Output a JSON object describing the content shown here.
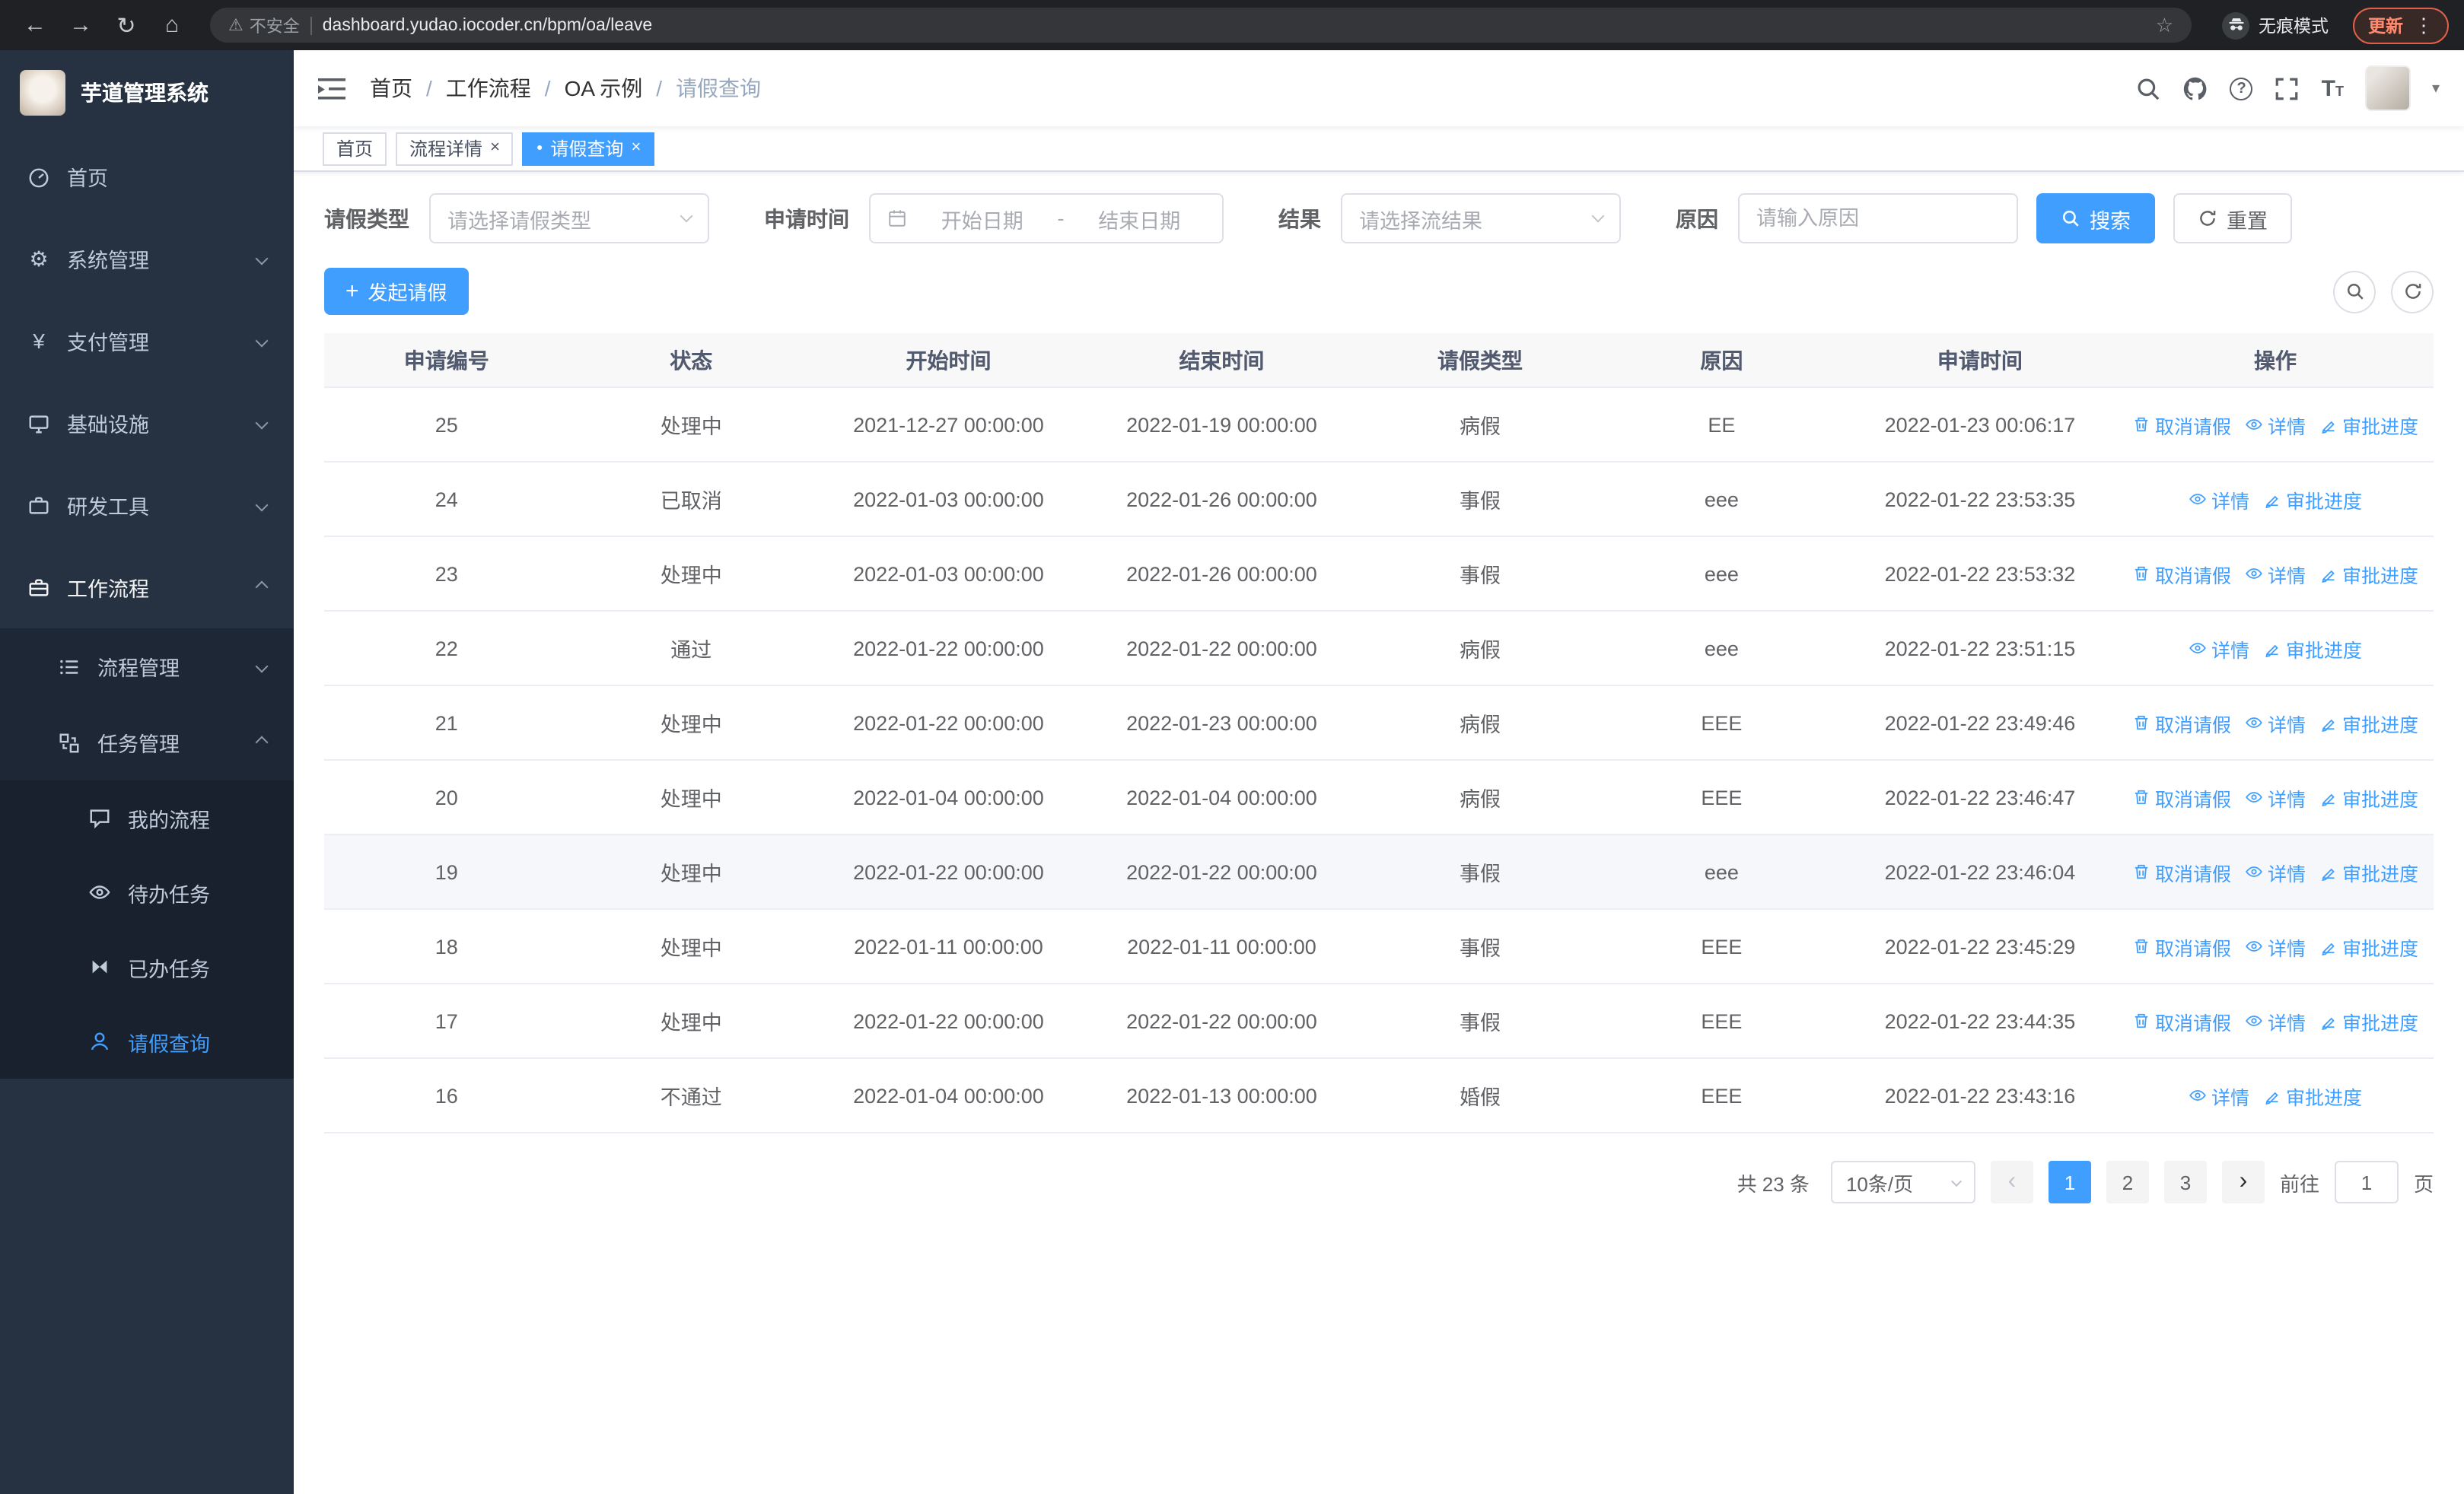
{
  "browser": {
    "security_label": "不安全",
    "url": "dashboard.yudao.iocoder.cn/bpm/oa/leave",
    "incognito_label": "无痕模式",
    "update_label": "更新"
  },
  "icons": {
    "back": "←",
    "forward": "→",
    "reload": "↻",
    "home": "⌂",
    "warning": "⚠",
    "star": "☆",
    "menu_dots": "⋮",
    "active_dot": "●",
    "close": "×",
    "plus": "+",
    "question": "?",
    "yen": "¥",
    "gear": "⚙",
    "caret_down": "▾",
    "chevron_left": "‹",
    "chevron_right": "›",
    "font_size_big": "T",
    "font_size_small": "T"
  },
  "sidebar": {
    "logo_title": "芋道管理系统",
    "home": "首页",
    "system": "系统管理",
    "payment": "支付管理",
    "infra": "基础设施",
    "devtools": "研发工具",
    "workflow": "工作流程",
    "process_mgmt": "流程管理",
    "task_mgmt": "任务管理",
    "my_process": "我的流程",
    "todo_tasks": "待办任务",
    "done_tasks": "已办任务",
    "leave_query": "请假查询"
  },
  "header": {
    "breadcrumb": [
      "首页",
      "工作流程",
      "OA 示例",
      "请假查询"
    ]
  },
  "tabs": {
    "home": "首页",
    "process_detail": "流程详情",
    "leave_query": "请假查询"
  },
  "filters": {
    "leave_type_label": "请假类型",
    "leave_type_placeholder": "请选择请假类型",
    "apply_time_label": "申请时间",
    "start_date_placeholder": "开始日期",
    "date_separator": "-",
    "end_date_placeholder": "结束日期",
    "result_label": "结果",
    "result_placeholder": "请选择流结果",
    "reason_label": "原因",
    "reason_placeholder": "请输入原因",
    "search_button": "搜索",
    "reset_button": "重置"
  },
  "toolbar": {
    "create_button": "发起请假"
  },
  "table": {
    "columns": [
      "申请编号",
      "状态",
      "开始时间",
      "结束时间",
      "请假类型",
      "原因",
      "申请时间",
      "操作"
    ],
    "actions": {
      "cancel": "取消请假",
      "detail": "详情",
      "progress": "审批进度"
    },
    "rows": [
      {
        "id": "25",
        "status": "处理中",
        "start": "2021-12-27 00:00:00",
        "end": "2022-01-19 00:00:00",
        "type": "病假",
        "reason": "EE",
        "apply_time": "2022-01-23 00:06:17",
        "cancelable": true,
        "highlighted": false
      },
      {
        "id": "24",
        "status": "已取消",
        "start": "2022-01-03 00:00:00",
        "end": "2022-01-26 00:00:00",
        "type": "事假",
        "reason": "eee",
        "apply_time": "2022-01-22 23:53:35",
        "cancelable": false,
        "highlighted": false
      },
      {
        "id": "23",
        "status": "处理中",
        "start": "2022-01-03 00:00:00",
        "end": "2022-01-26 00:00:00",
        "type": "事假",
        "reason": "eee",
        "apply_time": "2022-01-22 23:53:32",
        "cancelable": true,
        "highlighted": false
      },
      {
        "id": "22",
        "status": "通过",
        "start": "2022-01-22 00:00:00",
        "end": "2022-01-22 00:00:00",
        "type": "病假",
        "reason": "eee",
        "apply_time": "2022-01-22 23:51:15",
        "cancelable": false,
        "highlighted": false
      },
      {
        "id": "21",
        "status": "处理中",
        "start": "2022-01-22 00:00:00",
        "end": "2022-01-23 00:00:00",
        "type": "病假",
        "reason": "EEE",
        "apply_time": "2022-01-22 23:49:46",
        "cancelable": true,
        "highlighted": false
      },
      {
        "id": "20",
        "status": "处理中",
        "start": "2022-01-04 00:00:00",
        "end": "2022-01-04 00:00:00",
        "type": "病假",
        "reason": "EEE",
        "apply_time": "2022-01-22 23:46:47",
        "cancelable": true,
        "highlighted": false
      },
      {
        "id": "19",
        "status": "处理中",
        "start": "2022-01-22 00:00:00",
        "end": "2022-01-22 00:00:00",
        "type": "事假",
        "reason": "eee",
        "apply_time": "2022-01-22 23:46:04",
        "cancelable": true,
        "highlighted": true
      },
      {
        "id": "18",
        "status": "处理中",
        "start": "2022-01-11 00:00:00",
        "end": "2022-01-11 00:00:00",
        "type": "事假",
        "reason": "EEE",
        "apply_time": "2022-01-22 23:45:29",
        "cancelable": true,
        "highlighted": false
      },
      {
        "id": "17",
        "status": "处理中",
        "start": "2022-01-22 00:00:00",
        "end": "2022-01-22 00:00:00",
        "type": "事假",
        "reason": "EEE",
        "apply_time": "2022-01-22 23:44:35",
        "cancelable": true,
        "highlighted": false
      },
      {
        "id": "16",
        "status": "不通过",
        "start": "2022-01-04 00:00:00",
        "end": "2022-01-13 00:00:00",
        "type": "婚假",
        "reason": "EEE",
        "apply_time": "2022-01-22 23:43:16",
        "cancelable": false,
        "highlighted": false
      }
    ]
  },
  "pagination": {
    "total_label": "共 23 条",
    "page_size": "10条/页",
    "pages": [
      "1",
      "2",
      "3"
    ],
    "active_page": "1",
    "goto_label": "前往",
    "goto_value": "1",
    "page_label": "页"
  },
  "colors": {
    "primary": "#409eff",
    "sidebar_bg": "#263242",
    "chrome_bg": "#202124"
  }
}
